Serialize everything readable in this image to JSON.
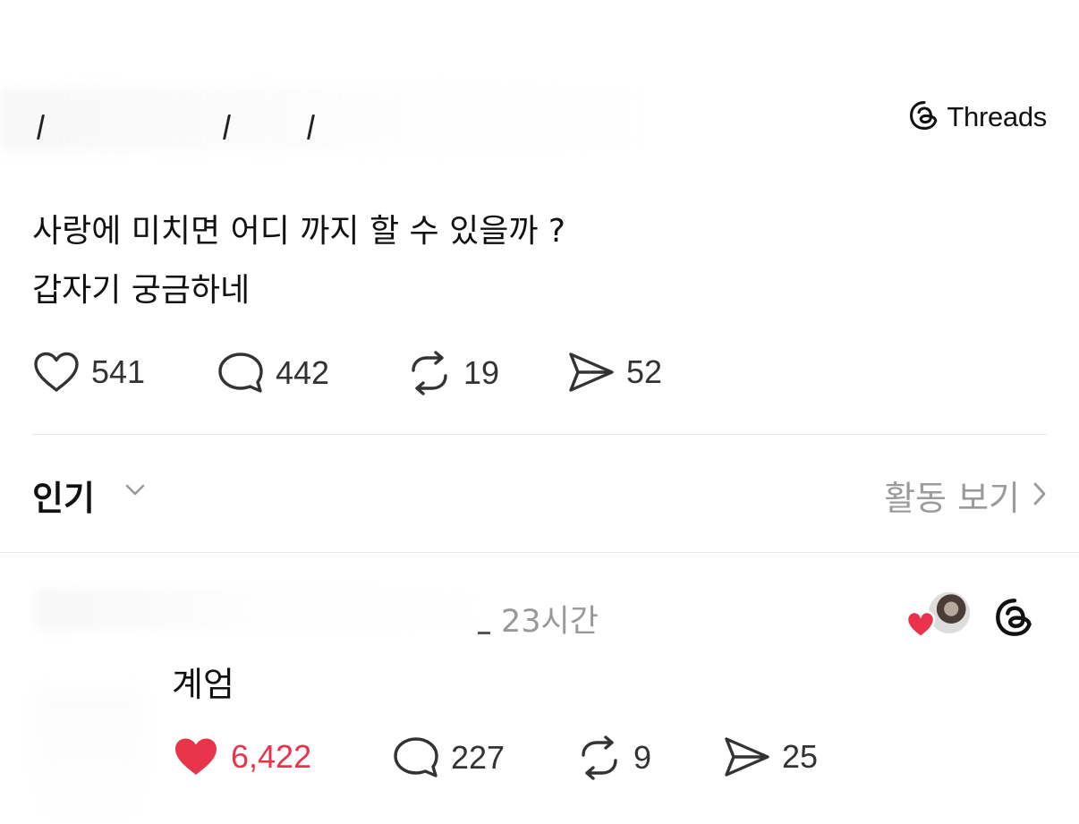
{
  "header": {
    "brand_label": "Threads"
  },
  "post": {
    "lines": [
      "사랑에 미치면 어디 까지 할 수 있을까 ?",
      "갑자기 궁금하네"
    ],
    "likes": "541",
    "replies": "442",
    "reposts": "19",
    "shares": "52"
  },
  "sort": {
    "label": "인기",
    "activity_label": "활동 보기"
  },
  "reply": {
    "time": "23시간",
    "text": "계엄",
    "likes": "6,422",
    "replies": "227",
    "reposts": "9",
    "shares": "25"
  },
  "colors": {
    "like_active": "#e8334a",
    "muted": "#9b9b9b",
    "divider": "#e6e6e6"
  },
  "icons": [
    "threads-icon",
    "heart-icon",
    "comment-icon",
    "repost-icon",
    "send-icon",
    "chevron-down-icon",
    "chevron-right-icon"
  ]
}
